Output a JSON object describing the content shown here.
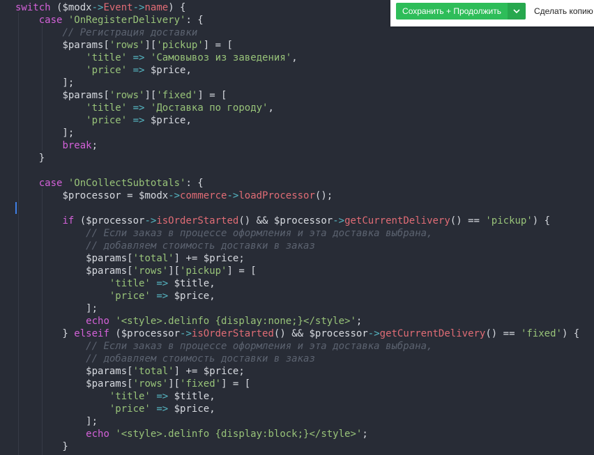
{
  "toolbar": {
    "save_continue_label": "Сохранить + Продолжить",
    "copy_label": "Сделать копию",
    "accent_color": "#2ebd59"
  },
  "code": {
    "lines": [
      [
        [
          "kw",
          "switch"
        ],
        [
          "plain",
          " ("
        ],
        [
          "var",
          "$modx"
        ],
        [
          "op",
          "->"
        ],
        [
          "fn",
          "Event"
        ],
        [
          "op",
          "->"
        ],
        [
          "fn",
          "name"
        ],
        [
          "plain",
          ") {"
        ]
      ],
      [
        [
          "plain",
          "    "
        ],
        [
          "kw",
          "case"
        ],
        [
          "plain",
          " "
        ],
        [
          "str",
          "'OnRegisterDelivery'"
        ],
        [
          "plain",
          ": {"
        ]
      ],
      [
        [
          "plain",
          "        "
        ],
        [
          "cmt",
          "// Регистрация доставки"
        ]
      ],
      [
        [
          "plain",
          "        "
        ],
        [
          "var",
          "$params"
        ],
        [
          "plain",
          "["
        ],
        [
          "str",
          "'rows'"
        ],
        [
          "plain",
          "]["
        ],
        [
          "str",
          "'pickup'"
        ],
        [
          "plain",
          "] = ["
        ]
      ],
      [
        [
          "plain",
          "            "
        ],
        [
          "str",
          "'title'"
        ],
        [
          "plain",
          " "
        ],
        [
          "op",
          "=>"
        ],
        [
          "plain",
          " "
        ],
        [
          "str",
          "'Самовывоз из заведения'"
        ],
        [
          "plain",
          ","
        ]
      ],
      [
        [
          "plain",
          "            "
        ],
        [
          "str",
          "'price'"
        ],
        [
          "plain",
          " "
        ],
        [
          "op",
          "=>"
        ],
        [
          "plain",
          " "
        ],
        [
          "var",
          "$price"
        ],
        [
          "plain",
          ","
        ]
      ],
      [
        [
          "plain",
          "        ];"
        ]
      ],
      [
        [
          "plain",
          "        "
        ],
        [
          "var",
          "$params"
        ],
        [
          "plain",
          "["
        ],
        [
          "str",
          "'rows'"
        ],
        [
          "plain",
          "]["
        ],
        [
          "str",
          "'fixed'"
        ],
        [
          "plain",
          "] = ["
        ]
      ],
      [
        [
          "plain",
          "            "
        ],
        [
          "str",
          "'title'"
        ],
        [
          "plain",
          " "
        ],
        [
          "op",
          "=>"
        ],
        [
          "plain",
          " "
        ],
        [
          "str",
          "'Доставка по городу'"
        ],
        [
          "plain",
          ","
        ]
      ],
      [
        [
          "plain",
          "            "
        ],
        [
          "str",
          "'price'"
        ],
        [
          "plain",
          " "
        ],
        [
          "op",
          "=>"
        ],
        [
          "plain",
          " "
        ],
        [
          "var",
          "$price"
        ],
        [
          "plain",
          ","
        ]
      ],
      [
        [
          "plain",
          "        ];"
        ]
      ],
      [
        [
          "plain",
          "        "
        ],
        [
          "kw",
          "break"
        ],
        [
          "plain",
          ";"
        ]
      ],
      [
        [
          "plain",
          "    }"
        ]
      ],
      [
        [
          "plain",
          ""
        ]
      ],
      [
        [
          "plain",
          "    "
        ],
        [
          "kw",
          "case"
        ],
        [
          "plain",
          " "
        ],
        [
          "str",
          "'OnCollectSubtotals'"
        ],
        [
          "plain",
          ": {"
        ]
      ],
      [
        [
          "plain",
          "        "
        ],
        [
          "var",
          "$processor"
        ],
        [
          "plain",
          " = "
        ],
        [
          "var",
          "$modx"
        ],
        [
          "op",
          "->"
        ],
        [
          "fn",
          "commerce"
        ],
        [
          "op",
          "->"
        ],
        [
          "fn",
          "loadProcessor"
        ],
        [
          "plain",
          "();"
        ]
      ],
      [
        [
          "plain",
          ""
        ]
      ],
      [
        [
          "plain",
          "        "
        ],
        [
          "kw",
          "if"
        ],
        [
          "plain",
          " ("
        ],
        [
          "var",
          "$processor"
        ],
        [
          "op",
          "->"
        ],
        [
          "fn",
          "isOrderStarted"
        ],
        [
          "plain",
          "() && "
        ],
        [
          "var",
          "$processor"
        ],
        [
          "op",
          "->"
        ],
        [
          "fn",
          "getCurrentDelivery"
        ],
        [
          "plain",
          "() == "
        ],
        [
          "str",
          "'pickup'"
        ],
        [
          "plain",
          ") {"
        ]
      ],
      [
        [
          "plain",
          "            "
        ],
        [
          "cmt",
          "// Если заказ в процессе оформления и эта доставка выбрана,"
        ]
      ],
      [
        [
          "plain",
          "            "
        ],
        [
          "cmt",
          "// добавляем стоимость доставки в заказ"
        ]
      ],
      [
        [
          "plain",
          "            "
        ],
        [
          "var",
          "$params"
        ],
        [
          "plain",
          "["
        ],
        [
          "str",
          "'total'"
        ],
        [
          "plain",
          "] += "
        ],
        [
          "var",
          "$price"
        ],
        [
          "plain",
          ";"
        ]
      ],
      [
        [
          "plain",
          "            "
        ],
        [
          "var",
          "$params"
        ],
        [
          "plain",
          "["
        ],
        [
          "str",
          "'rows'"
        ],
        [
          "plain",
          "]["
        ],
        [
          "str",
          "'pickup'"
        ],
        [
          "plain",
          "] = ["
        ]
      ],
      [
        [
          "plain",
          "                "
        ],
        [
          "str",
          "'title'"
        ],
        [
          "plain",
          " "
        ],
        [
          "op",
          "=>"
        ],
        [
          "plain",
          " "
        ],
        [
          "var",
          "$title"
        ],
        [
          "plain",
          ","
        ]
      ],
      [
        [
          "plain",
          "                "
        ],
        [
          "str",
          "'price'"
        ],
        [
          "plain",
          " "
        ],
        [
          "op",
          "=>"
        ],
        [
          "plain",
          " "
        ],
        [
          "var",
          "$price"
        ],
        [
          "plain",
          ","
        ]
      ],
      [
        [
          "plain",
          "            ];"
        ]
      ],
      [
        [
          "plain",
          "            "
        ],
        [
          "kw",
          "echo"
        ],
        [
          "plain",
          " "
        ],
        [
          "str",
          "'<style>.delinfo {display:none;}</style>'"
        ],
        [
          "plain",
          ";"
        ]
      ],
      [
        [
          "plain",
          "        } "
        ],
        [
          "kw",
          "elseif"
        ],
        [
          "plain",
          " ("
        ],
        [
          "var",
          "$processor"
        ],
        [
          "op",
          "->"
        ],
        [
          "fn",
          "isOrderStarted"
        ],
        [
          "plain",
          "() && "
        ],
        [
          "var",
          "$processor"
        ],
        [
          "op",
          "->"
        ],
        [
          "fn",
          "getCurrentDelivery"
        ],
        [
          "plain",
          "() == "
        ],
        [
          "str",
          "'fixed'"
        ],
        [
          "plain",
          ") {"
        ]
      ],
      [
        [
          "plain",
          "            "
        ],
        [
          "cmt",
          "// Если заказ в процессе оформления и эта доставка выбрана,"
        ]
      ],
      [
        [
          "plain",
          "            "
        ],
        [
          "cmt",
          "// добавляем стоимость доставки в заказ"
        ]
      ],
      [
        [
          "plain",
          "            "
        ],
        [
          "var",
          "$params"
        ],
        [
          "plain",
          "["
        ],
        [
          "str",
          "'total'"
        ],
        [
          "plain",
          "] += "
        ],
        [
          "var",
          "$price"
        ],
        [
          "plain",
          ";"
        ]
      ],
      [
        [
          "plain",
          "            "
        ],
        [
          "var",
          "$params"
        ],
        [
          "plain",
          "["
        ],
        [
          "str",
          "'rows'"
        ],
        [
          "plain",
          "]["
        ],
        [
          "str",
          "'fixed'"
        ],
        [
          "plain",
          "] = ["
        ]
      ],
      [
        [
          "plain",
          "                "
        ],
        [
          "str",
          "'title'"
        ],
        [
          "plain",
          " "
        ],
        [
          "op",
          "=>"
        ],
        [
          "plain",
          " "
        ],
        [
          "var",
          "$title"
        ],
        [
          "plain",
          ","
        ]
      ],
      [
        [
          "plain",
          "                "
        ],
        [
          "str",
          "'price'"
        ],
        [
          "plain",
          " "
        ],
        [
          "op",
          "=>"
        ],
        [
          "plain",
          " "
        ],
        [
          "var",
          "$price"
        ],
        [
          "plain",
          ","
        ]
      ],
      [
        [
          "plain",
          "            ];"
        ]
      ],
      [
        [
          "plain",
          "            "
        ],
        [
          "kw",
          "echo"
        ],
        [
          "plain",
          " "
        ],
        [
          "str",
          "'<style>.delinfo {display:block;}</style>'"
        ],
        [
          "plain",
          ";"
        ]
      ],
      [
        [
          "plain",
          "        }"
        ]
      ]
    ]
  }
}
